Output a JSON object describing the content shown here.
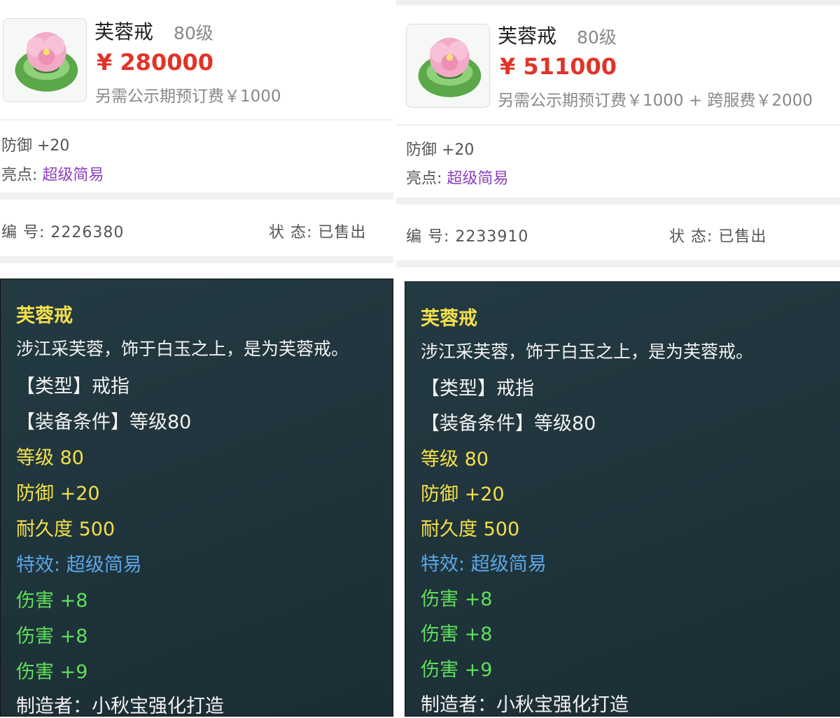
{
  "colors": {
    "price_red": "#e0342a",
    "highlight_purple": "#8a3fbf",
    "tooltip_bg": "#243a42",
    "yellow": "#f4e04a",
    "green": "#5ee05a",
    "blue": "#5aa7e6"
  },
  "left": {
    "item_icon": "lotus-ring-icon",
    "name": "芙蓉戒",
    "level": "80级",
    "price": "¥ 280000",
    "fee": "另需公示期预订费￥1000",
    "defense": "防御 +20",
    "highlight_label": "亮点:",
    "highlight_value": "超级简易",
    "id_label": "编 号:",
    "id_value": "2226380",
    "status_label": "状 态:",
    "status_value": "已售出",
    "tooltip": {
      "name": "芙蓉戒",
      "desc": "涉江采芙蓉，饰于白玉之上，是为芙蓉戒。",
      "type": "【类型】戒指",
      "req": "【装备条件】等级80",
      "lvl": "等级 80",
      "def": "防御 +20",
      "dur": "耐久度 500",
      "effect_label": "特效:",
      "effect_value": "超级简易",
      "dmg1": "伤害 +8",
      "dmg2": "伤害 +8",
      "dmg3": "伤害 +9",
      "maker": "制造者：小秋宝强化打造"
    }
  },
  "right": {
    "item_icon": "lotus-ring-icon",
    "name": "芙蓉戒",
    "level": "80级",
    "price": "¥ 511000",
    "fee": "另需公示期预订费￥1000 + 跨服费￥2000",
    "defense": "防御 +20",
    "highlight_label": "亮点:",
    "highlight_value": "超级简易",
    "id_label": "编 号:",
    "id_value": "2233910",
    "status_label": "状 态:",
    "status_value": "已售出",
    "tooltip": {
      "name": "芙蓉戒",
      "desc": "涉江采芙蓉，饰于白玉之上，是为芙蓉戒。",
      "type": "【类型】戒指",
      "req": "【装备条件】等级80",
      "lvl": "等级 80",
      "def": "防御 +20",
      "dur": "耐久度 500",
      "effect_label": "特效:",
      "effect_value": "超级简易",
      "dmg1": "伤害 +8",
      "dmg2": "伤害 +8",
      "dmg3": "伤害 +9",
      "maker": "制造者：小秋宝强化打造"
    }
  }
}
